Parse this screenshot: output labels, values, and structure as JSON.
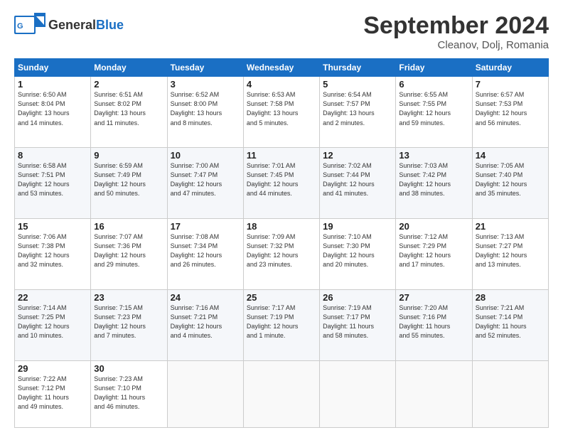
{
  "header": {
    "logo_general": "General",
    "logo_blue": "Blue",
    "month_title": "September 2024",
    "location": "Cleanov, Dolj, Romania"
  },
  "weekdays": [
    "Sunday",
    "Monday",
    "Tuesday",
    "Wednesday",
    "Thursday",
    "Friday",
    "Saturday"
  ],
  "weeks": [
    [
      {
        "day": "1",
        "info": "Sunrise: 6:50 AM\nSunset: 8:04 PM\nDaylight: 13 hours\nand 14 minutes."
      },
      {
        "day": "2",
        "info": "Sunrise: 6:51 AM\nSunset: 8:02 PM\nDaylight: 13 hours\nand 11 minutes."
      },
      {
        "day": "3",
        "info": "Sunrise: 6:52 AM\nSunset: 8:00 PM\nDaylight: 13 hours\nand 8 minutes."
      },
      {
        "day": "4",
        "info": "Sunrise: 6:53 AM\nSunset: 7:58 PM\nDaylight: 13 hours\nand 5 minutes."
      },
      {
        "day": "5",
        "info": "Sunrise: 6:54 AM\nSunset: 7:57 PM\nDaylight: 13 hours\nand 2 minutes."
      },
      {
        "day": "6",
        "info": "Sunrise: 6:55 AM\nSunset: 7:55 PM\nDaylight: 12 hours\nand 59 minutes."
      },
      {
        "day": "7",
        "info": "Sunrise: 6:57 AM\nSunset: 7:53 PM\nDaylight: 12 hours\nand 56 minutes."
      }
    ],
    [
      {
        "day": "8",
        "info": "Sunrise: 6:58 AM\nSunset: 7:51 PM\nDaylight: 12 hours\nand 53 minutes."
      },
      {
        "day": "9",
        "info": "Sunrise: 6:59 AM\nSunset: 7:49 PM\nDaylight: 12 hours\nand 50 minutes."
      },
      {
        "day": "10",
        "info": "Sunrise: 7:00 AM\nSunset: 7:47 PM\nDaylight: 12 hours\nand 47 minutes."
      },
      {
        "day": "11",
        "info": "Sunrise: 7:01 AM\nSunset: 7:45 PM\nDaylight: 12 hours\nand 44 minutes."
      },
      {
        "day": "12",
        "info": "Sunrise: 7:02 AM\nSunset: 7:44 PM\nDaylight: 12 hours\nand 41 minutes."
      },
      {
        "day": "13",
        "info": "Sunrise: 7:03 AM\nSunset: 7:42 PM\nDaylight: 12 hours\nand 38 minutes."
      },
      {
        "day": "14",
        "info": "Sunrise: 7:05 AM\nSunset: 7:40 PM\nDaylight: 12 hours\nand 35 minutes."
      }
    ],
    [
      {
        "day": "15",
        "info": "Sunrise: 7:06 AM\nSunset: 7:38 PM\nDaylight: 12 hours\nand 32 minutes."
      },
      {
        "day": "16",
        "info": "Sunrise: 7:07 AM\nSunset: 7:36 PM\nDaylight: 12 hours\nand 29 minutes."
      },
      {
        "day": "17",
        "info": "Sunrise: 7:08 AM\nSunset: 7:34 PM\nDaylight: 12 hours\nand 26 minutes."
      },
      {
        "day": "18",
        "info": "Sunrise: 7:09 AM\nSunset: 7:32 PM\nDaylight: 12 hours\nand 23 minutes."
      },
      {
        "day": "19",
        "info": "Sunrise: 7:10 AM\nSunset: 7:30 PM\nDaylight: 12 hours\nand 20 minutes."
      },
      {
        "day": "20",
        "info": "Sunrise: 7:12 AM\nSunset: 7:29 PM\nDaylight: 12 hours\nand 17 minutes."
      },
      {
        "day": "21",
        "info": "Sunrise: 7:13 AM\nSunset: 7:27 PM\nDaylight: 12 hours\nand 13 minutes."
      }
    ],
    [
      {
        "day": "22",
        "info": "Sunrise: 7:14 AM\nSunset: 7:25 PM\nDaylight: 12 hours\nand 10 minutes."
      },
      {
        "day": "23",
        "info": "Sunrise: 7:15 AM\nSunset: 7:23 PM\nDaylight: 12 hours\nand 7 minutes."
      },
      {
        "day": "24",
        "info": "Sunrise: 7:16 AM\nSunset: 7:21 PM\nDaylight: 12 hours\nand 4 minutes."
      },
      {
        "day": "25",
        "info": "Sunrise: 7:17 AM\nSunset: 7:19 PM\nDaylight: 12 hours\nand 1 minute."
      },
      {
        "day": "26",
        "info": "Sunrise: 7:19 AM\nSunset: 7:17 PM\nDaylight: 11 hours\nand 58 minutes."
      },
      {
        "day": "27",
        "info": "Sunrise: 7:20 AM\nSunset: 7:16 PM\nDaylight: 11 hours\nand 55 minutes."
      },
      {
        "day": "28",
        "info": "Sunrise: 7:21 AM\nSunset: 7:14 PM\nDaylight: 11 hours\nand 52 minutes."
      }
    ],
    [
      {
        "day": "29",
        "info": "Sunrise: 7:22 AM\nSunset: 7:12 PM\nDaylight: 11 hours\nand 49 minutes."
      },
      {
        "day": "30",
        "info": "Sunrise: 7:23 AM\nSunset: 7:10 PM\nDaylight: 11 hours\nand 46 minutes."
      },
      {
        "day": "",
        "info": ""
      },
      {
        "day": "",
        "info": ""
      },
      {
        "day": "",
        "info": ""
      },
      {
        "day": "",
        "info": ""
      },
      {
        "day": "",
        "info": ""
      }
    ]
  ]
}
